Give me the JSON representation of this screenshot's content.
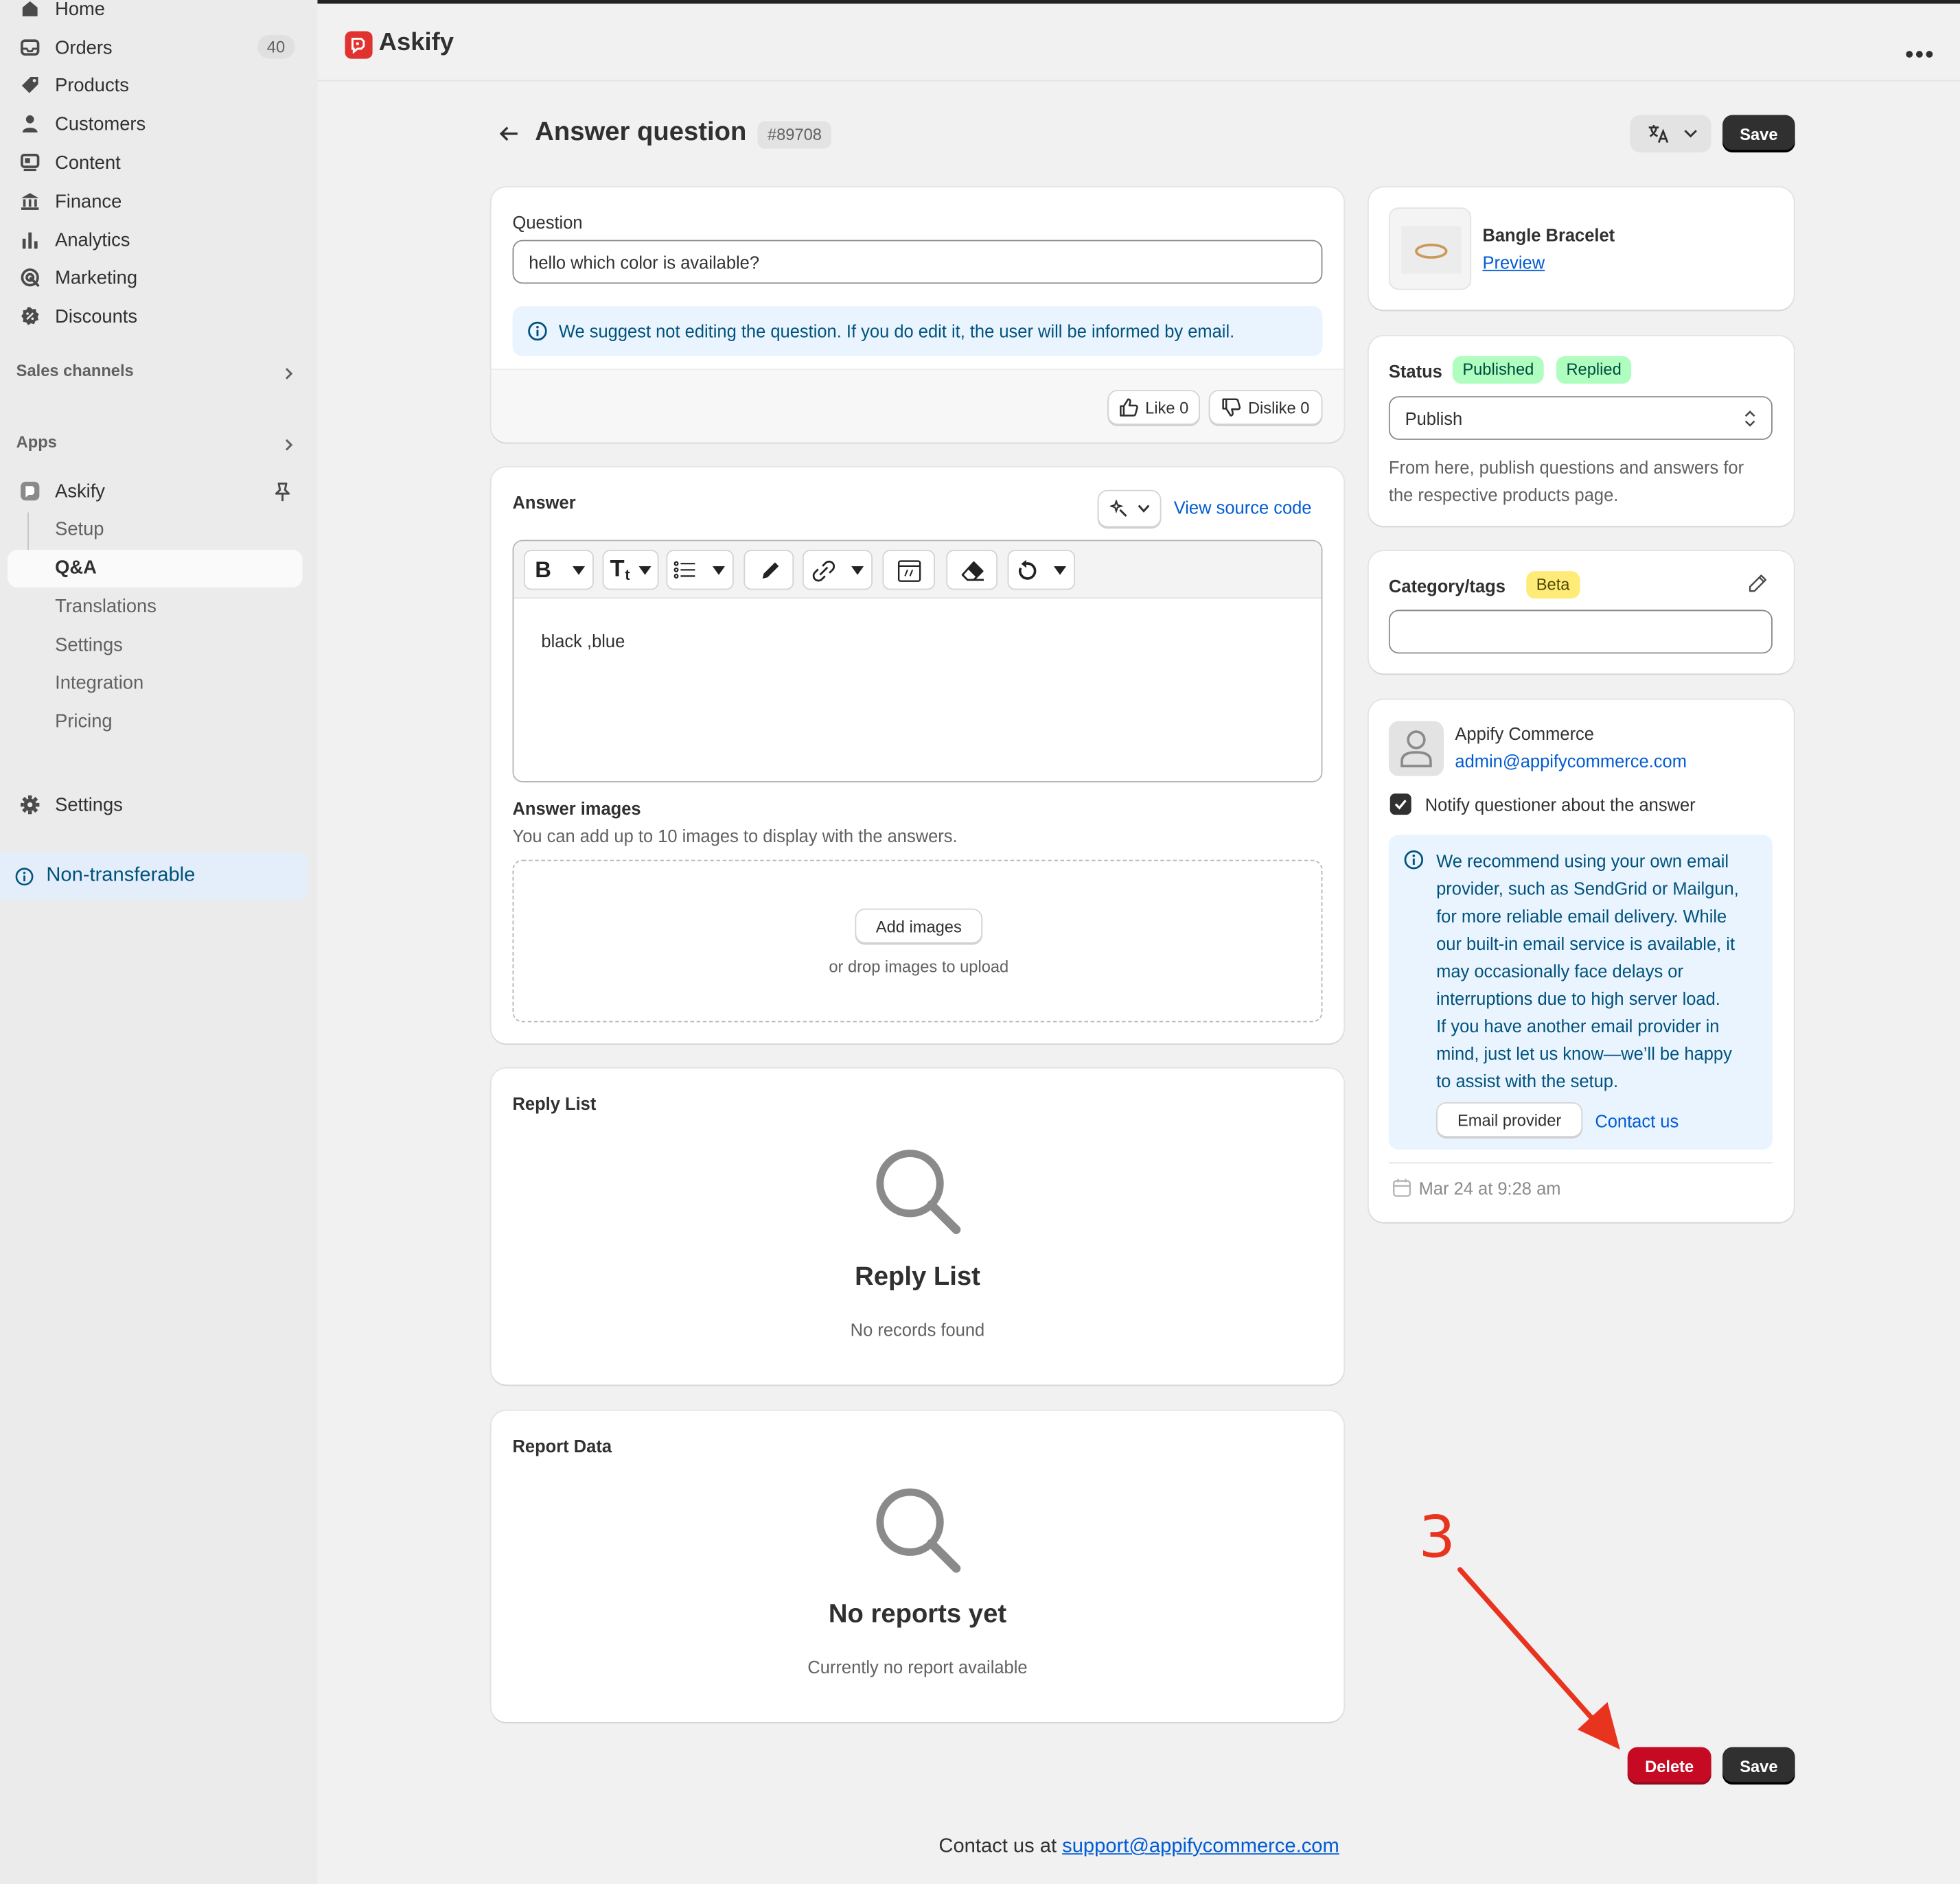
{
  "sidebar": {
    "nav": [
      {
        "label": "Home",
        "icon": "home-icon"
      },
      {
        "label": "Orders",
        "icon": "orders-icon",
        "badge": "40"
      },
      {
        "label": "Products",
        "icon": "tag-icon"
      },
      {
        "label": "Customers",
        "icon": "person-icon"
      },
      {
        "label": "Content",
        "icon": "content-icon"
      },
      {
        "label": "Finance",
        "icon": "bank-icon"
      },
      {
        "label": "Analytics",
        "icon": "bar-chart-icon"
      },
      {
        "label": "Marketing",
        "icon": "target-icon"
      },
      {
        "label": "Discounts",
        "icon": "discount-icon"
      }
    ],
    "sales_channels": "Sales channels",
    "apps": "Apps",
    "app": {
      "name": "Askify",
      "sub": [
        "Setup",
        "Q&A",
        "Translations",
        "Settings",
        "Integration",
        "Pricing"
      ]
    },
    "settings": "Settings",
    "non_transferable": "Non-transferable"
  },
  "header": {
    "app_name": "Askify"
  },
  "page": {
    "title": "Answer question",
    "id": "#89708",
    "save": "Save"
  },
  "question": {
    "label": "Question",
    "value": "hello which color is available?",
    "banner": "We suggest not editing the question. If you do edit it, the user will be informed by email.",
    "like": "Like 0",
    "dislike": "Dislike 0"
  },
  "answer": {
    "title": "Answer",
    "view_source": "View source code",
    "content": "black ,blue",
    "images_title": "Answer images",
    "images_hint": "You can add up to 10 images to display with the answers.",
    "add_images": "Add images",
    "drop_hint": "or drop images to upload"
  },
  "reply_list": {
    "title": "Reply List",
    "empty_title": "Reply List",
    "empty_sub": "No records found"
  },
  "report": {
    "title": "Report Data",
    "empty_title": "No reports yet",
    "empty_sub": "Currently no report available"
  },
  "product": {
    "name": "Bangle Bracelet",
    "preview": "Preview"
  },
  "status": {
    "label": "Status",
    "badges": [
      "Published",
      "Replied"
    ],
    "select": "Publish",
    "help": [
      "From here, publish questions and answers for",
      "the respective products page."
    ]
  },
  "category": {
    "label": "Category/tags",
    "badge": "Beta"
  },
  "customer": {
    "name": "Appify Commerce",
    "email": "admin@appifycommerce.com",
    "notify": "Notify questioner about the answer",
    "banner_lines": [
      "We recommend using your own email",
      "provider, such as SendGrid or Mailgun,",
      "for more reliable email delivery. While",
      "our built-in email service is available, it",
      "may occasionally face delays or",
      "interruptions due to high server load.",
      "If you have another email provider in",
      "mind, just let us know—we’ll be happy",
      "to assist with the setup."
    ],
    "email_provider": "Email provider",
    "contact_us": "Contact us",
    "date": "Mar 24 at 9:28 am"
  },
  "footer_actions": {
    "delete": "Delete",
    "save": "Save"
  },
  "annotation": {
    "number": "3"
  },
  "footer": {
    "prefix": "Contact us at ",
    "email": "support@appifycommerce.com"
  },
  "colors": {
    "accent": "#005bd3",
    "danger": "#c70a24",
    "success_bg": "#affebf",
    "beta_bg": "#ffeb78",
    "annotation": "#e8341f"
  }
}
